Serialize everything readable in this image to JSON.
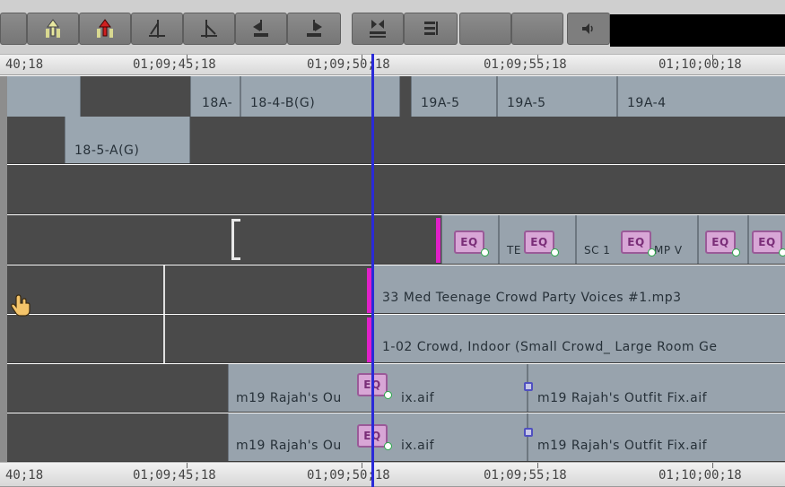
{
  "toolbar": {
    "buttons": [
      {
        "name": "lift-icon"
      },
      {
        "name": "extract-icon"
      },
      {
        "name": "trim-left-icon"
      },
      {
        "name": "trim-right-icon"
      },
      {
        "name": "overwrite-left-icon"
      },
      {
        "name": "overwrite-right-icon"
      },
      {
        "name": "splice-icon"
      },
      {
        "name": "list-icon"
      }
    ],
    "speaker_icon": "speaker-icon",
    "colors": {
      "toolbar_bg": "#cfcfcf",
      "button": "#808080",
      "meter": "#000000"
    }
  },
  "ruler": {
    "labels": [
      "40;18",
      "01;09;45;18",
      "01;09;50;18",
      "01;09;55;18",
      "01;10;00;18"
    ]
  },
  "tracks": {
    "v2": {
      "clips": [
        {
          "label": "18A-"
        },
        {
          "label": "18-4-B(G)"
        },
        {
          "label": "19A-5"
        },
        {
          "label": "19A-5"
        },
        {
          "label": "19A-4"
        }
      ]
    },
    "v1": {
      "clips": [
        {
          "label": "18-5-A(G)"
        }
      ]
    },
    "a1": {
      "eq_labels": [
        "EQ",
        "EQ",
        "EQ",
        "EQ",
        "EQ"
      ],
      "fragments": [
        "TE",
        "SC 1",
        "MP V"
      ]
    },
    "a2": {
      "clip_label": "33 Med Teenage Crowd Party Voices #1.mp3"
    },
    "a3": {
      "clip_label": "1-02 Crowd, Indoor (Small Crowd_ Large Room Ge"
    },
    "a4": {
      "eq": "EQ",
      "clip1": {
        "prefix": "m19 Rajah's Ou",
        "suffix": "ix.aif"
      },
      "clip2": "m19 Rajah's Outfit Fix.aif"
    },
    "a5": {
      "eq": "EQ",
      "clip1": {
        "prefix": "m19 Rajah's Ou",
        "suffix": "ix.aif"
      },
      "clip2": "m19 Rajah's Outfit Fix.aif"
    }
  },
  "colors": {
    "playhead": "#2a2ad8",
    "clip": "#98a3ad",
    "track": "#4a4a4a",
    "eq": "#d8a6d6",
    "transition": "#e020c8"
  }
}
